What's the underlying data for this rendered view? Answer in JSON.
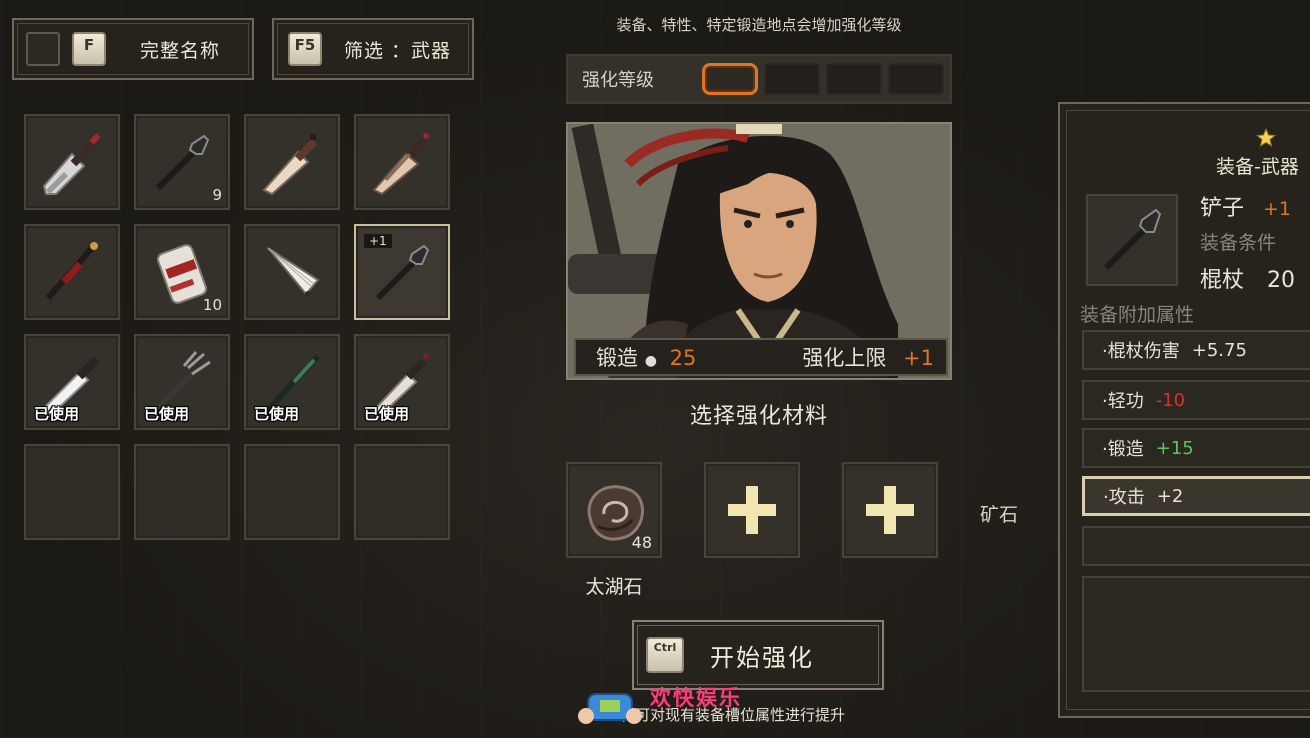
{
  "header": {
    "name_toggle": {
      "key": "F",
      "label": "完整名称"
    },
    "filter": {
      "key": "F5",
      "label": "筛选 ：武器"
    }
  },
  "inventory": {
    "items": [
      {
        "name": "cleaver-icon",
        "count": "",
        "plus": "",
        "used": ""
      },
      {
        "name": "shovel-icon",
        "count": "9",
        "plus": "",
        "used": ""
      },
      {
        "name": "dagger-icon",
        "count": "",
        "plus": "",
        "used": ""
      },
      {
        "name": "wrapped-blade-icon",
        "count": "",
        "plus": "",
        "used": ""
      },
      {
        "name": "crimson-rod-icon",
        "count": "",
        "plus": "",
        "used": ""
      },
      {
        "name": "scroll-icon",
        "count": "10",
        "plus": "",
        "used": ""
      },
      {
        "name": "fan-icon",
        "count": "",
        "plus": "",
        "used": ""
      },
      {
        "name": "shovel-icon",
        "count": "",
        "plus": "+1",
        "used": ""
      },
      {
        "name": "sword-icon",
        "count": "",
        "plus": "",
        "used": "已使用"
      },
      {
        "name": "trident-icon",
        "count": "",
        "plus": "",
        "used": "已使用"
      },
      {
        "name": "jade-staff-icon",
        "count": "",
        "plus": "",
        "used": "已使用"
      },
      {
        "name": "short-sword-icon",
        "count": "",
        "plus": "",
        "used": "已使用"
      }
    ]
  },
  "forge": {
    "hint": "装备、特性、特定锻造地点会增加强化等级",
    "level_label": "强化等级",
    "level_active": 1,
    "level_total": 4,
    "forge_label": "锻造",
    "forge_value": "25",
    "cap_label": "强化上限",
    "cap_value": "+1",
    "select_title": "选择强化材料",
    "material": {
      "name": "太湖石",
      "count": "48"
    },
    "ore_label": "矿石",
    "start_key": "Ctrl",
    "start_label": "开始强化",
    "footnote": "化可对现有装备槽位属性进行提升",
    "watermark": "欢快娱乐"
  },
  "detail": {
    "type": "装备-武器",
    "name": "铲子",
    "name_plus": "+1",
    "req_label": "装备条件",
    "req_stat": "棍杖",
    "req_value": "20",
    "attrs_label": "装备附加属性",
    "attrs": [
      {
        "label": "·棍杖伤害",
        "value": "+5.75",
        "color": "#e8e2d2"
      },
      {
        "label": "·轻功",
        "value": "-10",
        "color": "#d8312a"
      },
      {
        "label": "·锻造",
        "value": "+15",
        "color": "#5cc45a"
      },
      {
        "label": "·攻击",
        "value": "+2",
        "color": "#e8e2d2"
      }
    ]
  }
}
